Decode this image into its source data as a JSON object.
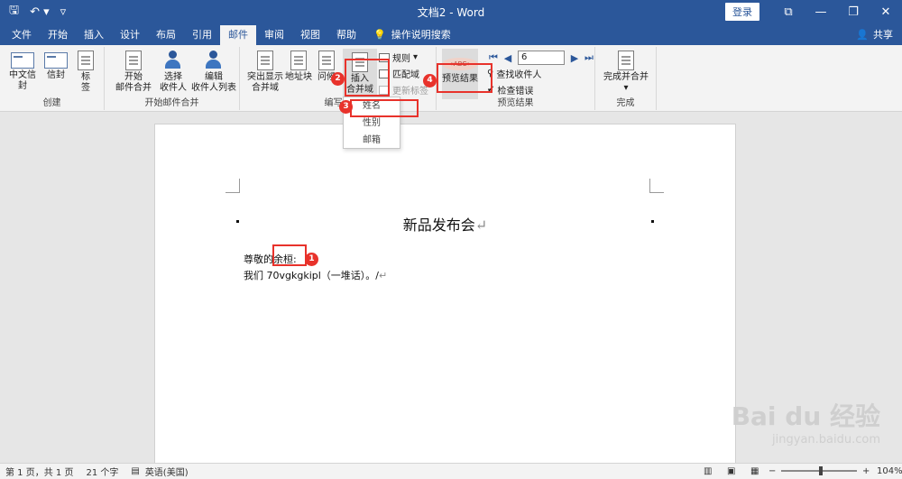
{
  "titlebar": {
    "title": "文档2 - Word",
    "login": "登录"
  },
  "tabs": [
    "文件",
    "开始",
    "插入",
    "设计",
    "布局",
    "引用",
    "邮件",
    "审阅",
    "视图",
    "帮助"
  ],
  "active_tab": "邮件",
  "tell_me": "操作说明搜索",
  "share": "共享",
  "ribbon": {
    "create": {
      "label": "创建",
      "cn_envelope": "中文信封",
      "envelope": "信封",
      "labels": "标签"
    },
    "start": {
      "label": "开始邮件合并",
      "start_merge": [
        "开始",
        "邮件合并"
      ],
      "select_recipients": [
        "选择",
        "收件人"
      ],
      "edit_list": [
        "编辑",
        "收件人列表"
      ]
    },
    "write": {
      "label": "编写和",
      "highlight": [
        "突出显示",
        "合并域"
      ],
      "address": "地址块",
      "greeting": "问候",
      "insert_field": [
        "插入",
        "合并域"
      ],
      "rules": "规则",
      "match": "匹配域",
      "update": "更新标签"
    },
    "preview": {
      "label": "预览结果",
      "preview_btn": "预览结果",
      "record": "6",
      "find": "查找收件人",
      "check": "检查错误"
    },
    "finish": {
      "label": "完成",
      "finish_merge": [
        "完成并合并"
      ]
    }
  },
  "dropdown": [
    "姓名",
    "性别",
    "邮箱"
  ],
  "document": {
    "title": "新品发布会",
    "salutation_prefix": "尊敬的",
    "salutation_field": "余桓",
    "salutation_suffix": ":",
    "body": "我们 70vgkgkipl（一堆话）。/"
  },
  "markers": [
    "1",
    "2",
    "3",
    "4"
  ],
  "watermark": {
    "main": "Bai du 经验",
    "sub": "jingyan.baidu.com"
  },
  "status": {
    "page": "第 1 页，共 1 页",
    "words": "21 个字",
    "lang": "英语(美国)",
    "zoom": "104%"
  },
  "colors": {
    "accent": "#2b579a",
    "highlight": "#e8322b"
  }
}
